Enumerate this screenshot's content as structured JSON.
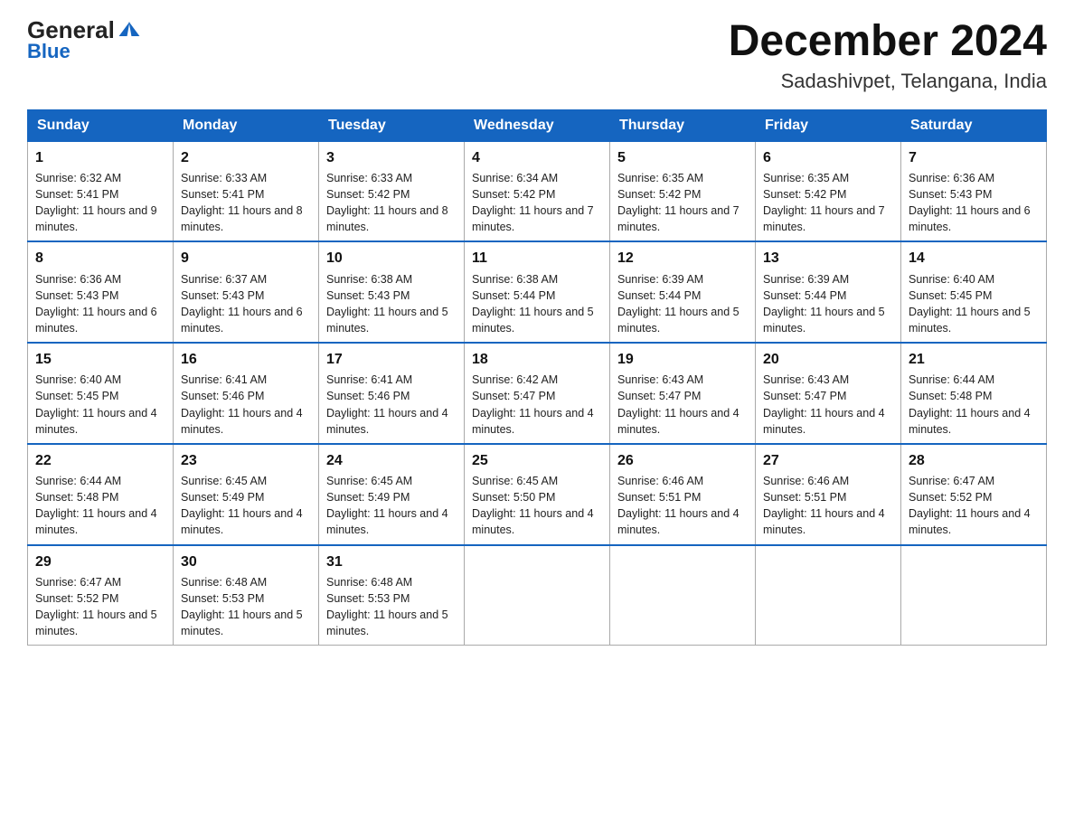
{
  "logo": {
    "general": "General",
    "blue": "Blue"
  },
  "title": "December 2024",
  "location": "Sadashivpet, Telangana, India",
  "days_of_week": [
    "Sunday",
    "Monday",
    "Tuesday",
    "Wednesday",
    "Thursday",
    "Friday",
    "Saturday"
  ],
  "weeks": [
    [
      {
        "day": "1",
        "sunrise": "6:32 AM",
        "sunset": "5:41 PM",
        "daylight": "11 hours and 9 minutes."
      },
      {
        "day": "2",
        "sunrise": "6:33 AM",
        "sunset": "5:41 PM",
        "daylight": "11 hours and 8 minutes."
      },
      {
        "day": "3",
        "sunrise": "6:33 AM",
        "sunset": "5:42 PM",
        "daylight": "11 hours and 8 minutes."
      },
      {
        "day": "4",
        "sunrise": "6:34 AM",
        "sunset": "5:42 PM",
        "daylight": "11 hours and 7 minutes."
      },
      {
        "day": "5",
        "sunrise": "6:35 AM",
        "sunset": "5:42 PM",
        "daylight": "11 hours and 7 minutes."
      },
      {
        "day": "6",
        "sunrise": "6:35 AM",
        "sunset": "5:42 PM",
        "daylight": "11 hours and 7 minutes."
      },
      {
        "day": "7",
        "sunrise": "6:36 AM",
        "sunset": "5:43 PM",
        "daylight": "11 hours and 6 minutes."
      }
    ],
    [
      {
        "day": "8",
        "sunrise": "6:36 AM",
        "sunset": "5:43 PM",
        "daylight": "11 hours and 6 minutes."
      },
      {
        "day": "9",
        "sunrise": "6:37 AM",
        "sunset": "5:43 PM",
        "daylight": "11 hours and 6 minutes."
      },
      {
        "day": "10",
        "sunrise": "6:38 AM",
        "sunset": "5:43 PM",
        "daylight": "11 hours and 5 minutes."
      },
      {
        "day": "11",
        "sunrise": "6:38 AM",
        "sunset": "5:44 PM",
        "daylight": "11 hours and 5 minutes."
      },
      {
        "day": "12",
        "sunrise": "6:39 AM",
        "sunset": "5:44 PM",
        "daylight": "11 hours and 5 minutes."
      },
      {
        "day": "13",
        "sunrise": "6:39 AM",
        "sunset": "5:44 PM",
        "daylight": "11 hours and 5 minutes."
      },
      {
        "day": "14",
        "sunrise": "6:40 AM",
        "sunset": "5:45 PM",
        "daylight": "11 hours and 5 minutes."
      }
    ],
    [
      {
        "day": "15",
        "sunrise": "6:40 AM",
        "sunset": "5:45 PM",
        "daylight": "11 hours and 4 minutes."
      },
      {
        "day": "16",
        "sunrise": "6:41 AM",
        "sunset": "5:46 PM",
        "daylight": "11 hours and 4 minutes."
      },
      {
        "day": "17",
        "sunrise": "6:41 AM",
        "sunset": "5:46 PM",
        "daylight": "11 hours and 4 minutes."
      },
      {
        "day": "18",
        "sunrise": "6:42 AM",
        "sunset": "5:47 PM",
        "daylight": "11 hours and 4 minutes."
      },
      {
        "day": "19",
        "sunrise": "6:43 AM",
        "sunset": "5:47 PM",
        "daylight": "11 hours and 4 minutes."
      },
      {
        "day": "20",
        "sunrise": "6:43 AM",
        "sunset": "5:47 PM",
        "daylight": "11 hours and 4 minutes."
      },
      {
        "day": "21",
        "sunrise": "6:44 AM",
        "sunset": "5:48 PM",
        "daylight": "11 hours and 4 minutes."
      }
    ],
    [
      {
        "day": "22",
        "sunrise": "6:44 AM",
        "sunset": "5:48 PM",
        "daylight": "11 hours and 4 minutes."
      },
      {
        "day": "23",
        "sunrise": "6:45 AM",
        "sunset": "5:49 PM",
        "daylight": "11 hours and 4 minutes."
      },
      {
        "day": "24",
        "sunrise": "6:45 AM",
        "sunset": "5:49 PM",
        "daylight": "11 hours and 4 minutes."
      },
      {
        "day": "25",
        "sunrise": "6:45 AM",
        "sunset": "5:50 PM",
        "daylight": "11 hours and 4 minutes."
      },
      {
        "day": "26",
        "sunrise": "6:46 AM",
        "sunset": "5:51 PM",
        "daylight": "11 hours and 4 minutes."
      },
      {
        "day": "27",
        "sunrise": "6:46 AM",
        "sunset": "5:51 PM",
        "daylight": "11 hours and 4 minutes."
      },
      {
        "day": "28",
        "sunrise": "6:47 AM",
        "sunset": "5:52 PM",
        "daylight": "11 hours and 4 minutes."
      }
    ],
    [
      {
        "day": "29",
        "sunrise": "6:47 AM",
        "sunset": "5:52 PM",
        "daylight": "11 hours and 5 minutes."
      },
      {
        "day": "30",
        "sunrise": "6:48 AM",
        "sunset": "5:53 PM",
        "daylight": "11 hours and 5 minutes."
      },
      {
        "day": "31",
        "sunrise": "6:48 AM",
        "sunset": "5:53 PM",
        "daylight": "11 hours and 5 minutes."
      },
      null,
      null,
      null,
      null
    ]
  ]
}
